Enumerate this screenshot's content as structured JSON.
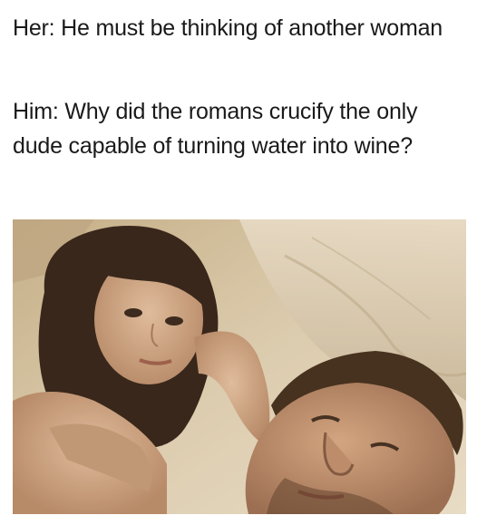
{
  "caption": {
    "her_line": "Her: He must be thinking of another woman",
    "him_line": "Him: Why did the romans crucify the only dude capable of turning water into wine?"
  },
  "photo": {
    "subject": "couple-in-bed-photo"
  }
}
